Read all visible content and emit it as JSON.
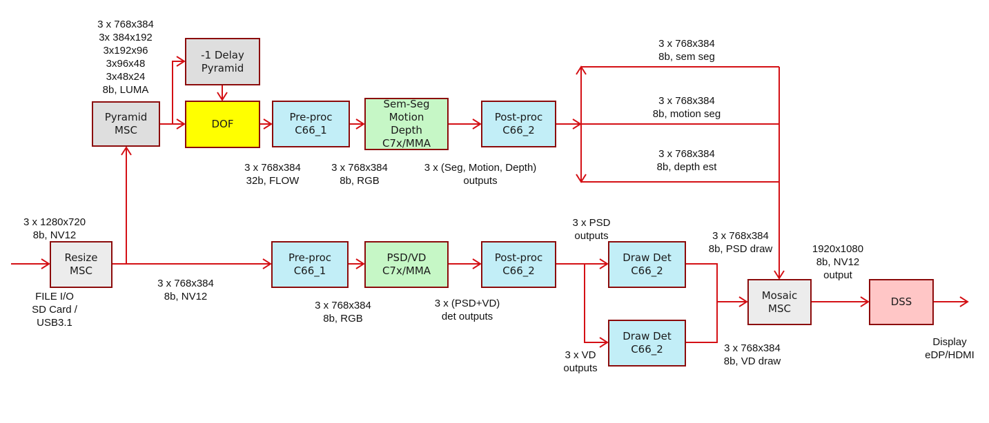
{
  "colors": {
    "wire": "#d40f14",
    "box_border": "#8b0a0a",
    "gray": "#dedede",
    "yellow": "#ffff00",
    "cyan": "#c2eef7",
    "green": "#c6f7c6",
    "pink": "#ffc6c6"
  },
  "blocks": {
    "resize_msc": [
      "Resize",
      "MSC"
    ],
    "pyramid_msc": [
      "Pyramid",
      "MSC"
    ],
    "delay_pyramid": [
      "-1 Delay",
      "Pyramid"
    ],
    "dof": [
      "DOF"
    ],
    "preproc_top": [
      "Pre-proc",
      "C66_1"
    ],
    "semseg": [
      "Sem-Seg",
      "Motion",
      "Depth",
      "C7x/MMA"
    ],
    "postproc_top": [
      "Post-proc",
      "C66_2"
    ],
    "preproc_bottom": [
      "Pre-proc",
      "C66_1"
    ],
    "psdvd": [
      "PSD/VD",
      "C7x/MMA"
    ],
    "postproc_bottom": [
      "Post-proc",
      "C66_2"
    ],
    "drawdet_psd": [
      "Draw Det",
      "C66_2"
    ],
    "drawdet_vd": [
      "Draw Det",
      "C66_2"
    ],
    "mosaic_msc": [
      "Mosaic",
      "MSC"
    ],
    "dss": [
      "DSS"
    ]
  },
  "labels": {
    "pyramid_out": [
      "3 x 768x384",
      "3x 384x192",
      "3x192x96",
      "3x96x48",
      "3x48x24",
      "8b, LUMA"
    ],
    "input": [
      "3 x 1280x720",
      "8b, NV12"
    ],
    "file_io": [
      "FILE I/O",
      "SD Card /",
      "USB3.1"
    ],
    "resize_out": [
      "3 x 768x384",
      "8b, NV12"
    ],
    "dof_out": [
      "3 x 768x384",
      "32b, FLOW"
    ],
    "preproc_top_out": [
      "3 x 768x384",
      "8b, RGB"
    ],
    "semseg_out": [
      "3 x (Seg, Motion, Depth)",
      "outputs"
    ],
    "sem_seg": [
      "3 x 768x384",
      "8b, sem seg"
    ],
    "motion_seg": [
      "3 x 768x384",
      "8b, motion seg"
    ],
    "depth_est": [
      "3 x 768x384",
      "8b, depth est"
    ],
    "preproc_bottom_out": [
      "3 x 768x384",
      "8b, RGB"
    ],
    "psdvd_out": [
      "3 x (PSD+VD)",
      "det outputs"
    ],
    "psd_outputs": [
      "3 x PSD",
      "outputs"
    ],
    "vd_outputs": [
      "3 x VD",
      "outputs"
    ],
    "psd_draw": [
      "3 x 768x384",
      "8b, PSD draw"
    ],
    "vd_draw": [
      "3 x 768x384",
      "8b, VD draw"
    ],
    "mosaic_out": [
      "1920x1080",
      "8b, NV12",
      "output"
    ],
    "display": [
      "Display",
      "eDP/HDMI"
    ]
  }
}
